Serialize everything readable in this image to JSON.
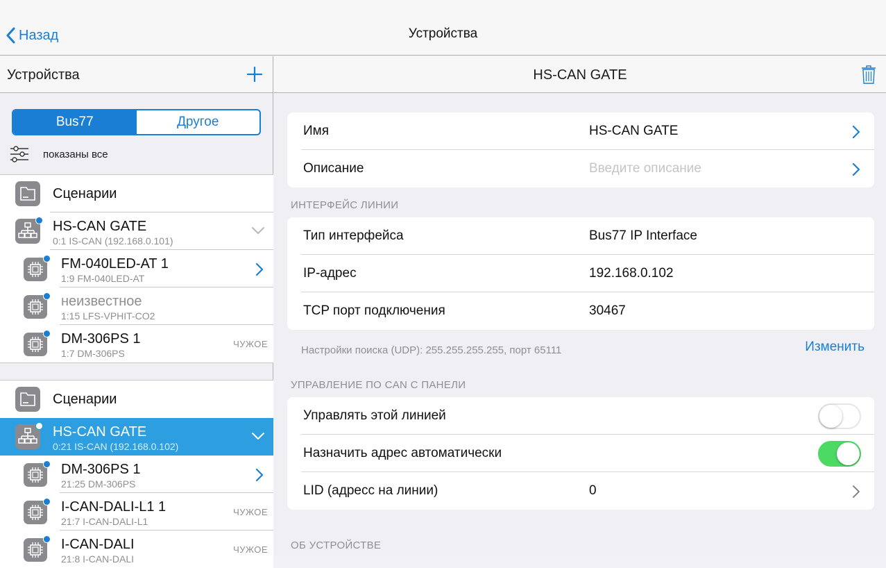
{
  "nav": {
    "back_label": "Назад",
    "title": "Устройства"
  },
  "left": {
    "title": "Устройства",
    "segments": [
      "Bus77",
      "Другое"
    ],
    "filter_label": "показаны все",
    "group1": {
      "scenarios": "Сценарии",
      "gate": {
        "name": "HS-CAN GATE",
        "sub": "0:1 IS-CAN (192.168.0.101)"
      },
      "devices": [
        {
          "name": "FM-040LED-AT 1",
          "sub": "1:9 FM-040LED-AT",
          "badge": ""
        },
        {
          "name": "неизвестное",
          "sub": "1:15 LFS-VPHIT-CO2",
          "badge": ""
        },
        {
          "name": "DM-306PS 1",
          "sub": "1:7 DM-306PS",
          "badge": "ЧУЖОЕ"
        }
      ]
    },
    "group2": {
      "scenarios": "Сценарии",
      "gate": {
        "name": "HS-CAN GATE",
        "sub": "0:21 IS-CAN (192.168.0.102)"
      },
      "devices": [
        {
          "name": "DM-306PS 1",
          "sub": "21:25 DM-306PS",
          "badge": ""
        },
        {
          "name": "I-CAN-DALI-L1 1",
          "sub": "21:7 I-CAN-DALI-L1",
          "badge": "ЧУЖОЕ"
        },
        {
          "name": "I-CAN-DALI",
          "sub": "21:8 I-CAN-DALI",
          "badge": "ЧУЖОЕ"
        }
      ]
    }
  },
  "detail": {
    "title": "HS-CAN GATE",
    "name_label": "Имя",
    "name_value": "HS-CAN GATE",
    "desc_label": "Описание",
    "desc_placeholder": "Введите описание",
    "section_interface": "ИНТЕРФЕЙС ЛИНИИ",
    "iface_type_label": "Тип интерфейса",
    "iface_type_value": "Bus77 IP Interface",
    "ip_label": "IP-адрес",
    "ip_value": "192.168.0.102",
    "tcp_label": "TCP порт подключения",
    "tcp_value": "30467",
    "udp_text": "Настройки поиска (UDP): 255.255.255.255, порт 65111",
    "change_label": "Изменить",
    "section_can": "УПРАВЛЕНИЕ ПО CAN С ПАНЕЛИ",
    "manage_label": "Управлять этой линией",
    "manage_on": false,
    "auto_label": "Назначить адрес автоматически",
    "auto_on": true,
    "lid_label": "LID (адресс на линии)",
    "lid_value": "0",
    "section_about": "ОБ УСТРОЙСТВЕ"
  },
  "colors": {
    "accent": "#1a7fd4",
    "selected_row": "#2d9ee0",
    "toggle_on": "#4cd964"
  }
}
